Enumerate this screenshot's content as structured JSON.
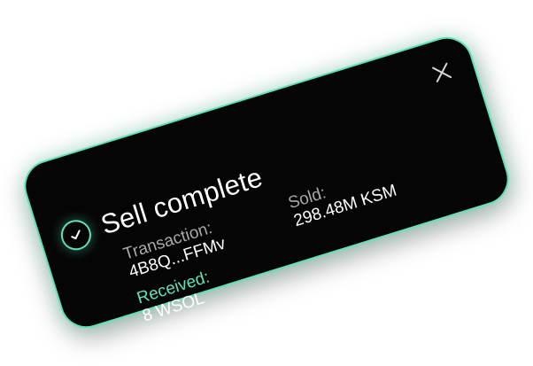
{
  "toast": {
    "title": "Sell complete",
    "icon": "check-circle-icon",
    "close_icon": "close-icon",
    "transaction": {
      "label": "Transaction:",
      "value": "4B8Q...FFMv"
    },
    "sold": {
      "label": "Sold:",
      "value": "298.48M KSM"
    },
    "received": {
      "label": "Received:",
      "value": "8 WSOL"
    }
  },
  "colors": {
    "background": "#050505",
    "accent": "#5fe1bb",
    "label": "#a9a9a9",
    "text": "#ffffff"
  }
}
